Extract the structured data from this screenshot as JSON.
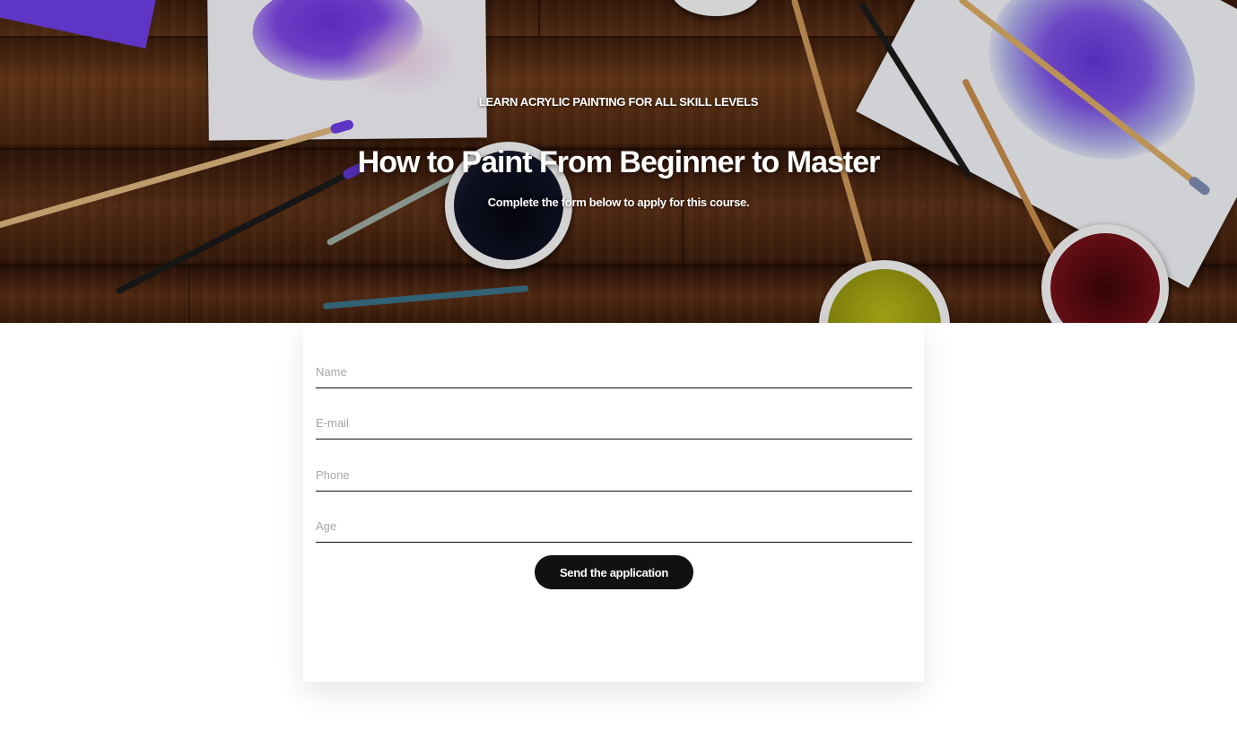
{
  "hero": {
    "eyebrow": "LEARN ACRYLIC PAINTING FOR ALL SKILL LEVELS",
    "title": "How to Paint From Beginner to Master",
    "subtitle": "Complete the form below to apply for this course."
  },
  "form": {
    "fields": [
      {
        "placeholder": "Name",
        "value": ""
      },
      {
        "placeholder": "E-mail",
        "value": ""
      },
      {
        "placeholder": "Phone",
        "value": ""
      },
      {
        "placeholder": "Age",
        "value": ""
      }
    ],
    "submit_label": "Send the application"
  },
  "colors": {
    "button": "#111111",
    "field_underline": "#111111",
    "placeholder": "#a6a6a6",
    "hero_text": "#ffffff"
  }
}
